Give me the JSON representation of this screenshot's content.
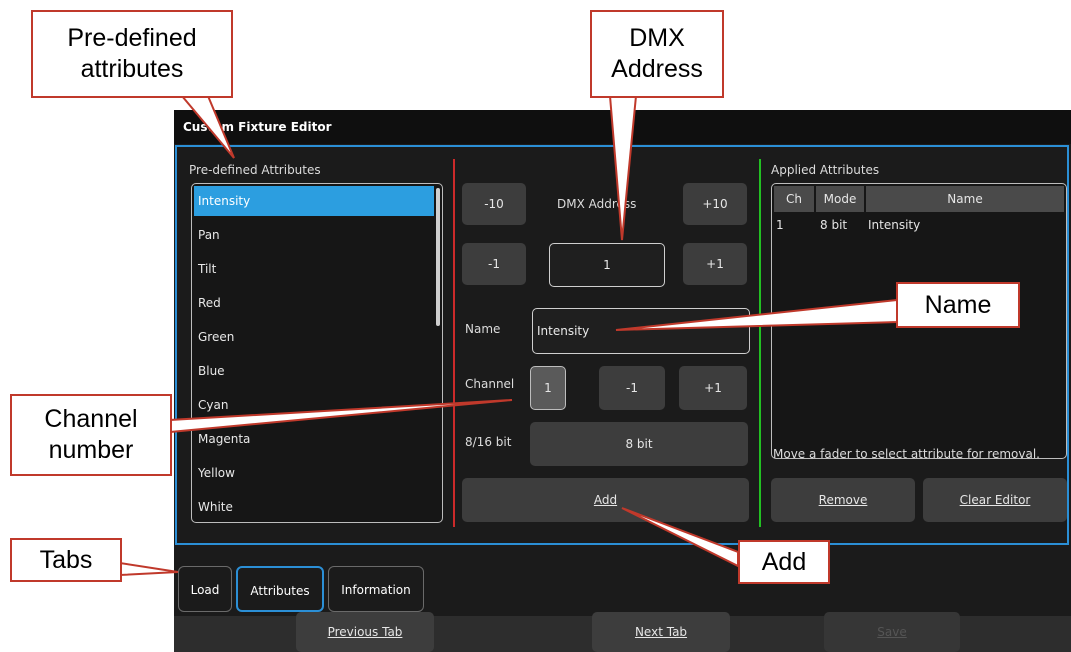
{
  "window": {
    "title": "Custom Fixture Editor"
  },
  "predefined": {
    "heading": "Pre-defined Attributes",
    "items": [
      "Intensity",
      "Pan",
      "Tilt",
      "Red",
      "Green",
      "Blue",
      "Cyan",
      "Magenta",
      "Yellow",
      "White"
    ],
    "selected": "Intensity"
  },
  "dmx": {
    "label": "DMX Address",
    "minus10": "-10",
    "plus10": "+10",
    "minus1": "-1",
    "plus1": "+1",
    "value": "1"
  },
  "name": {
    "label": "Name",
    "value": "Intensity"
  },
  "channel": {
    "label": "Channel",
    "value": "1",
    "minus1": "-1",
    "plus1": "+1"
  },
  "bit": {
    "label": "8/16 bit",
    "value": "8 bit"
  },
  "add_label": "Add",
  "applied": {
    "heading": "Applied Attributes",
    "columns": [
      "Ch",
      "Mode",
      "Name"
    ],
    "rows": [
      {
        "ch": "1",
        "mode": "8 bit",
        "name": "Intensity"
      }
    ],
    "hint": "Move a fader to select attribute for removal.",
    "remove_label": "Remove",
    "clear_label": "Clear Editor"
  },
  "tabs": [
    "Load",
    "Attributes",
    "Information"
  ],
  "active_tab": "Attributes",
  "footer": {
    "previous": "Previous Tab",
    "next": "Next Tab",
    "save": "Save"
  },
  "callouts": {
    "predefined": "Pre-defined attributes",
    "dmx": "DMX Address",
    "name": "Name",
    "channel": "Channel number",
    "tabs": "Tabs",
    "add": "Add"
  },
  "colors": {
    "accent": "#2b8fd6",
    "selection": "#2c9ee0",
    "callout_border": "#c0392b",
    "divider_red": "#cc2a2a",
    "divider_green": "#22c022"
  }
}
